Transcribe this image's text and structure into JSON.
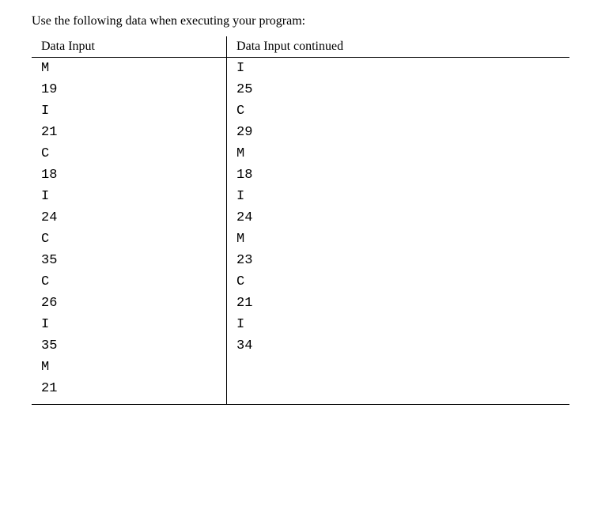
{
  "intro": "Use the following data when executing your program:",
  "headers": {
    "left": "Data Input",
    "right": "Data Input continued"
  },
  "columns": {
    "left": [
      "M",
      "19",
      "I",
      "21",
      "C",
      "18",
      "I",
      "24",
      "C",
      "35",
      "C",
      "26",
      "I",
      "35",
      "M",
      "21"
    ],
    "right": [
      "I",
      "25",
      "C",
      "29",
      "M",
      "18",
      "I",
      "24",
      "M",
      "23",
      "C",
      "21",
      "I",
      "34"
    ]
  }
}
